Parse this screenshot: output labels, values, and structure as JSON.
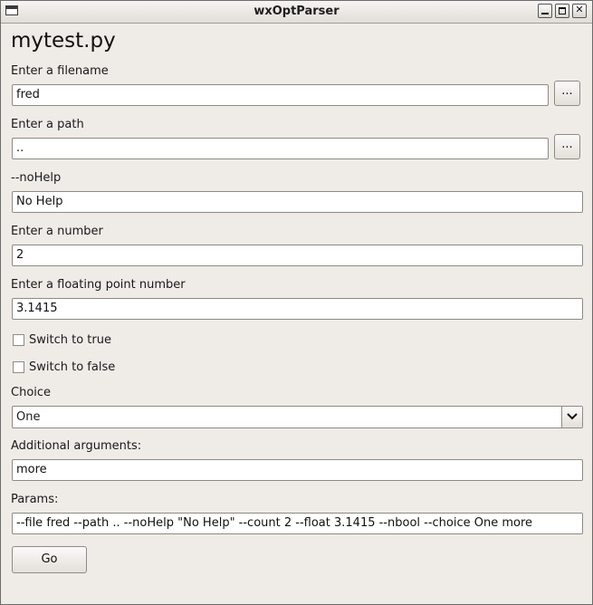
{
  "window": {
    "title": "wxOptParser"
  },
  "heading": "mytest.py",
  "fields": {
    "filename": {
      "label": "Enter a filename",
      "value": "fred",
      "browse_label": "..."
    },
    "path": {
      "label": "Enter a path",
      "value": "..",
      "browse_label": "..."
    },
    "nohelp": {
      "label": "--noHelp",
      "value": "No Help"
    },
    "number": {
      "label": "Enter a number",
      "value": "2"
    },
    "float": {
      "label": "Enter a floating point number",
      "value": "3.1415"
    }
  },
  "checkboxes": {
    "switch_true": {
      "label": "Switch to true",
      "checked": false
    },
    "switch_false": {
      "label": "Switch to false",
      "checked": false
    }
  },
  "choice": {
    "label": "Choice",
    "selected": "One",
    "icon": "chevron-down-icon"
  },
  "additional": {
    "label": "Additional arguments:",
    "value": "more"
  },
  "params": {
    "label": "Params:",
    "value": "--file fred --path .. --noHelp \"No Help\" --count 2 --float 3.1415 --nbool --choice One more"
  },
  "go_label": "Go"
}
